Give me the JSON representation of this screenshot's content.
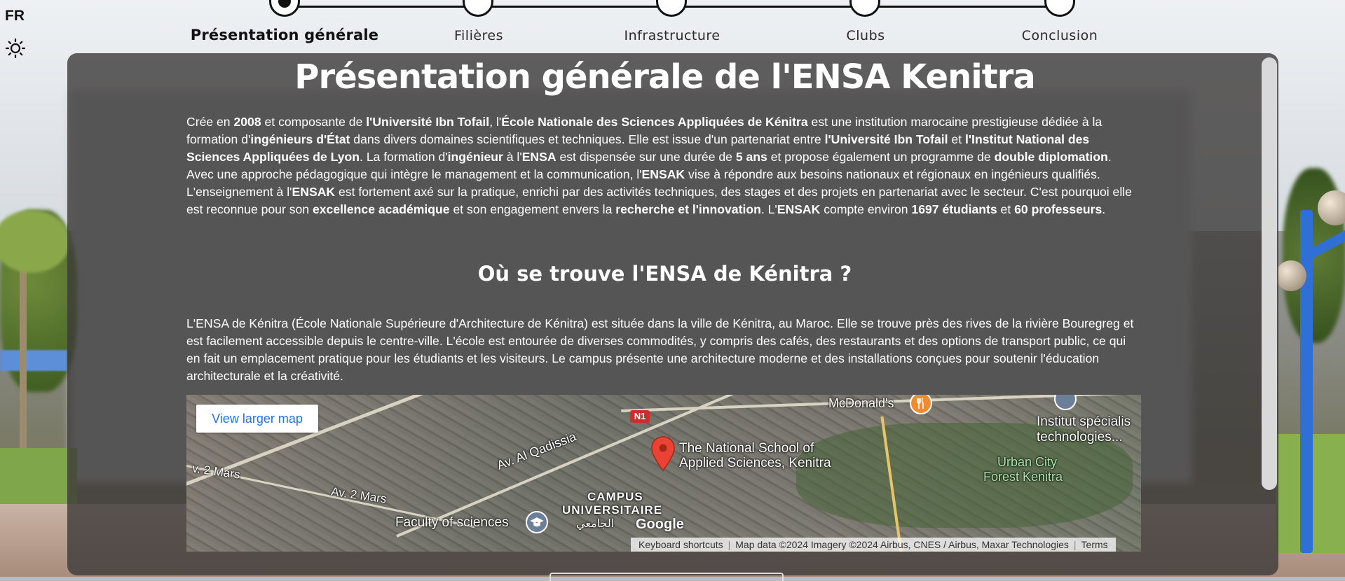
{
  "lang": "FR",
  "stepper": {
    "steps": [
      {
        "label": "Présentation générale",
        "active": true
      },
      {
        "label": "Filières",
        "active": false
      },
      {
        "label": "Infrastructure",
        "active": false
      },
      {
        "label": "Clubs",
        "active": false
      },
      {
        "label": "Conclusion",
        "active": false
      }
    ]
  },
  "main": {
    "title": "Présentation générale de l'ENSA Kenitra",
    "intro_segments": [
      {
        "t": "Crée en ",
        "b": false
      },
      {
        "t": "2008",
        "b": true
      },
      {
        "t": " et composante de ",
        "b": false
      },
      {
        "t": "l'Université Ibn Tofail",
        "b": true
      },
      {
        "t": ", l'",
        "b": false
      },
      {
        "t": "École Nationale des Sciences Appliquées de Kénitra",
        "b": true
      },
      {
        "t": " est une institution marocaine prestigieuse dédiée à la formation d'",
        "b": false
      },
      {
        "t": "ingénieurs d'État",
        "b": true
      },
      {
        "t": " dans divers domaines scientifiques et techniques. Elle est issue d'un partenariat entre ",
        "b": false
      },
      {
        "t": "l'Université Ibn Tofail",
        "b": true
      },
      {
        "t": " et ",
        "b": false
      },
      {
        "t": "l'Institut National des Sciences Appliquées de Lyon",
        "b": true
      },
      {
        "t": ". La formation d'",
        "b": false
      },
      {
        "t": "ingénieur",
        "b": true
      },
      {
        "t": " à l'",
        "b": false
      },
      {
        "t": "ENSA",
        "b": true
      },
      {
        "t": " est dispensée sur une durée de ",
        "b": false
      },
      {
        "t": "5 ans",
        "b": true
      },
      {
        "t": " et propose également un programme de ",
        "b": false
      },
      {
        "t": "double diplomation",
        "b": true
      },
      {
        "t": ". Avec une approche pédagogique qui intègre le management et la communication, l'",
        "b": false
      },
      {
        "t": "ENSAK",
        "b": true
      },
      {
        "t": " vise à répondre aux besoins nationaux et régionaux en ingénieurs qualifiés. L'enseignement à l'",
        "b": false
      },
      {
        "t": "ENSAK",
        "b": true
      },
      {
        "t": " est fortement axé sur la pratique, enrichi par des activités techniques, des stages et des projets en partenariat avec le secteur. C'est pourquoi elle est reconnue pour son ",
        "b": false
      },
      {
        "t": "excellence académique",
        "b": true
      },
      {
        "t": " et son engagement envers la ",
        "b": false
      },
      {
        "t": "recherche et l'innovation",
        "b": true
      },
      {
        "t": ". L'",
        "b": false
      },
      {
        "t": "ENSAK",
        "b": true
      },
      {
        "t": " compte environ ",
        "b": false
      },
      {
        "t": "1697 étudiants",
        "b": true
      },
      {
        "t": " et ",
        "b": false
      },
      {
        "t": "60 professeurs",
        "b": true
      },
      {
        "t": ".",
        "b": false
      }
    ],
    "subtitle": "Où se trouve l'ENSA de Kénitra ?",
    "location_text": "L'ENSA de Kénitra (École Nationale Supérieure d'Architecture de Kénitra) est située dans la ville de Kénitra, au Maroc. Elle se trouve près des rives de la rivière Bouregreg et est facilement accessible depuis le centre-ville. L'école est entourée de diverses commodités, y compris des cafés, des restaurants et des options de transport public, ce qui en fait un emplacement pratique pour les étudiants et les visiteurs. Le campus présente une architecture moderne et des installations conçues pour soutenir l'éducation architecturale et la créativité."
  },
  "map": {
    "view_larger": "View larger map",
    "labels": {
      "mcdonalds": "McDonald's",
      "institut_line1": "Institut spécialis",
      "institut_line2": "technologies...",
      "av_qadissia": "Av. Al Qadissia",
      "av_2mars_left": "v. 2 Mars",
      "av_2mars": "Av. 2 Mars",
      "school_line1": "The National School of",
      "school_line2": "Applied Sciences, Kenitra",
      "urban_line1": "Urban City",
      "urban_line2": "Forest Kenitra",
      "campus_line1": "CAMPUS",
      "campus_line2": "UNIVERSITAIRE",
      "campus_line3": "الجامعي",
      "faculty": "Faculty of sciences",
      "n1": "N1",
      "google": "Google"
    },
    "attribution": {
      "shortcuts": "Keyboard shortcuts",
      "data": "Map data ©2024 Imagery ©2024 Airbus, CNES / Airbus, Maxar Technologies",
      "terms": "Terms"
    }
  },
  "colors": {
    "panel_bg": "#3c3a38",
    "link_blue": "#1a73e8",
    "pin_red": "#ea4335",
    "poi_orange": "#f28b30"
  },
  "icons": {
    "theme_toggle": "sun-icon",
    "map_pin": "map-pin-icon",
    "restaurant": "restaurant-icon",
    "school": "school-icon"
  }
}
